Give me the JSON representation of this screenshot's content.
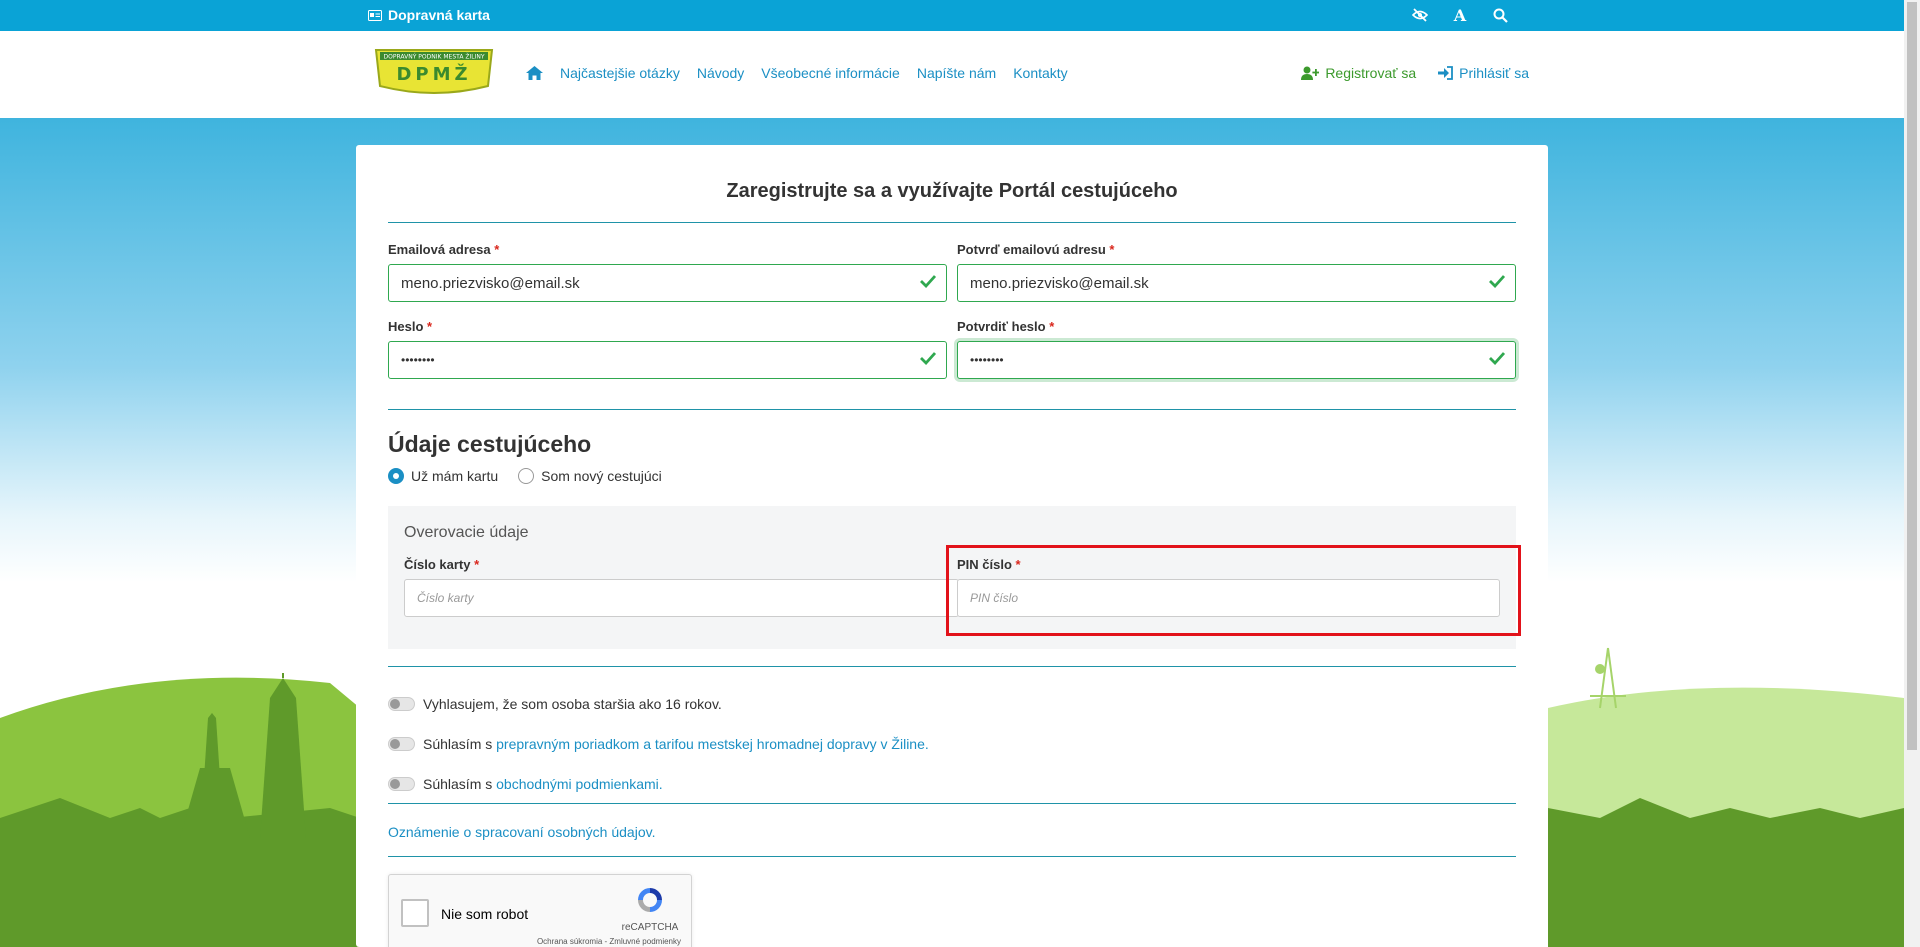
{
  "topbar": {
    "title": "Dopravná karta",
    "tools": [
      {
        "icon": "eye-slash-icon"
      },
      {
        "icon": "font-size-icon",
        "glyph": "A"
      },
      {
        "icon": "search-icon"
      }
    ]
  },
  "header": {
    "logo_text": "DPMŽ",
    "logo_subtext": "DOPRAVNÝ PODNIK MESTA ŽILINY",
    "nav": [
      "Najčastejšie otázky",
      "Návody",
      "Všeobecné informácie",
      "Napíšte nám",
      "Kontakty"
    ],
    "register": "Registrovať sa",
    "login": "Prihlásiť sa"
  },
  "form": {
    "title": "Zaregistrujte sa a využívajte Portál cestujúceho",
    "email_label": "Emailová adresa",
    "email_value": "meno.priezvisko@email.sk",
    "email_confirm_label": "Potvrď emailovú adresu",
    "email_confirm_value": "meno.priezvisko@email.sk",
    "password_label": "Heslo",
    "password_value": "••••••••",
    "password_confirm_label": "Potvrdiť heslo",
    "password_confirm_value": "••••••••",
    "required_mark": "*"
  },
  "traveler": {
    "title": "Údaje cestujúceho",
    "radio_have_card": "Už mám kartu",
    "radio_new": "Som nový cestujúci",
    "verify_title": "Overovacie údaje",
    "card_number_label": "Číslo karty",
    "card_number_placeholder": "Číslo karty",
    "pin_label": "PIN číslo",
    "pin_placeholder": "PIN číslo"
  },
  "consents": {
    "age": "Vyhlasujem, že som osoba staršia ako 16 rokov.",
    "transport_prefix": "Súhlasím s ",
    "transport_link": "prepravným poriadkom a tarifou mestskej hromadnej dopravy v Žiline.",
    "terms_prefix": "Súhlasím s ",
    "terms_link": "obchodnými podmienkami."
  },
  "notice": "Oznámenie o spracovaní osobných údajov.",
  "recaptcha": {
    "label": "Nie som robot",
    "brand": "reCAPTCHA",
    "links": "Ochrana súkromia - Zmluvné podmienky"
  },
  "colors": {
    "topbar": "#0aa3d6",
    "link": "#1b8fc4",
    "valid": "#2fa84f",
    "highlight": "#e2121a"
  }
}
